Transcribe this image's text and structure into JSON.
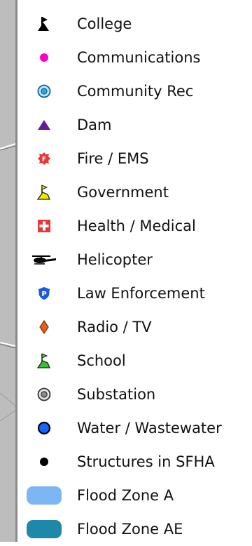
{
  "legend": {
    "items": [
      {
        "icon": "college-icon",
        "label": "College",
        "color": "#000000"
      },
      {
        "icon": "communications-icon",
        "label": "Communications",
        "color": "#ff00cc"
      },
      {
        "icon": "community-rec-icon",
        "label": "Community Rec",
        "color": "#29a9e0"
      },
      {
        "icon": "dam-icon",
        "label": "Dam",
        "color": "#6a1b9a"
      },
      {
        "icon": "fire-ems-icon",
        "label": "Fire / EMS",
        "color": "#e53935"
      },
      {
        "icon": "government-icon",
        "label": "Government",
        "color": "#f5e300"
      },
      {
        "icon": "health-medical-icon",
        "label": "Health / Medical",
        "color": "#e53935"
      },
      {
        "icon": "helicopter-icon",
        "label": "Helicopter",
        "color": "#000000"
      },
      {
        "icon": "law-enforcement-icon",
        "label": "Law Enforcement",
        "color": "#1e5bd8"
      },
      {
        "icon": "radio-tv-icon",
        "label": "Radio / TV",
        "color": "#e0601b"
      },
      {
        "icon": "school-icon",
        "label": "School",
        "color": "#39c42f"
      },
      {
        "icon": "substation-icon",
        "label": "Substation",
        "color": "#7a7a7a"
      },
      {
        "icon": "water-wastewater-icon",
        "label": "Water / Wastewater",
        "color": "#1565ff"
      },
      {
        "icon": "structures-sfha-icon",
        "label": "Structures in SFHA",
        "color": "#000000"
      },
      {
        "icon": "flood-zone-a-swatch",
        "label": "Flood Zone A",
        "color": "#7db6f3"
      },
      {
        "icon": "flood-zone-ae-swatch",
        "label": "Flood Zone AE",
        "color": "#1e88a8"
      }
    ]
  }
}
